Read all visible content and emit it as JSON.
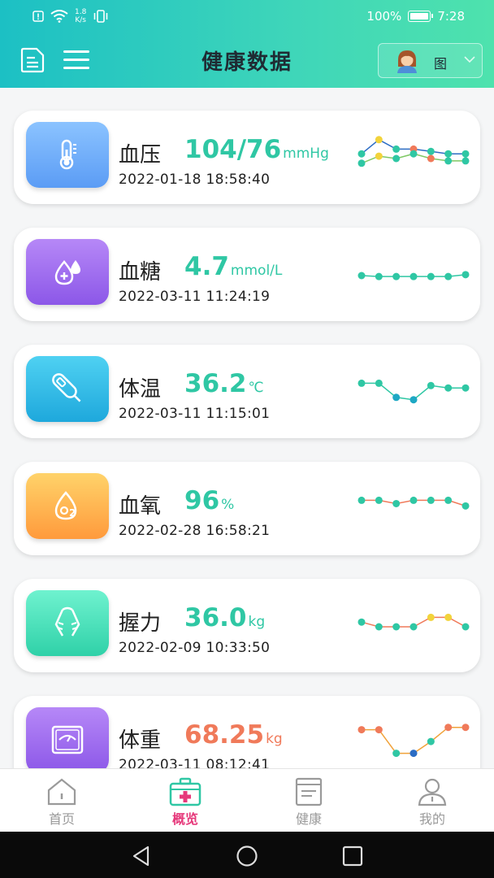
{
  "status_bar": {
    "net_speed_value": "1.8",
    "net_speed_unit": "K/s",
    "battery": "100%",
    "time": "7:28"
  },
  "header": {
    "title": "健康数据",
    "user_label": "图"
  },
  "cards": [
    {
      "name": "血压",
      "value": "104/76",
      "unit": "mmHg",
      "timestamp": "2022-01-18 18:58:40",
      "icon": "thermometer-icon",
      "gradient": [
        "#8bc3ff",
        "#5b9cf5"
      ],
      "value_color": "#2fc7a4",
      "sparkline": {
        "y_range": [
          0,
          10
        ],
        "series": [
          {
            "values": [
              6,
              9,
              7,
              7,
              6.5,
              6,
              6
            ],
            "line_color": "#2b6cc4",
            "points": [
              "#2fc7a4",
              "#f2d33b",
              "#2fc7a4",
              "#f07a5a",
              "#2fc7a4",
              "#2fc7a4",
              "#2fc7a4"
            ]
          },
          {
            "values": [
              4,
              5.5,
              5,
              6,
              5,
              4.5,
              4.5
            ],
            "line_color": "#7ec864",
            "points": [
              "#2fc7a4",
              "#f2d33b",
              "#2fc7a4",
              "#2fc7a4",
              "#f07a5a",
              "#2fc7a4",
              "#2fc7a4"
            ]
          }
        ]
      }
    },
    {
      "name": "血糖",
      "value": "4.7",
      "unit": "mmol/L",
      "timestamp": "2022-03-11 11:24:19",
      "icon": "blood-drop-icon",
      "gradient": [
        "#b688f7",
        "#8c57e8"
      ],
      "value_color": "#2fc7a4",
      "sparkline": {
        "y_range": [
          0,
          10
        ],
        "series": [
          {
            "values": [
              5,
              4.8,
              4.8,
              4.8,
              4.8,
              4.8,
              5.2
            ],
            "line_color": "#2fc7a4",
            "points": [
              "#2fc7a4",
              "#2fc7a4",
              "#2fc7a4",
              "#2fc7a4",
              "#2fc7a4",
              "#2fc7a4",
              "#2fc7a4"
            ]
          }
        ]
      }
    },
    {
      "name": "体温",
      "value": "36.2",
      "unit": "℃",
      "timestamp": "2022-03-11 11:15:01",
      "icon": "digital-thermometer-icon",
      "gradient": [
        "#4fd1f2",
        "#1ea8dc"
      ],
      "value_color": "#2fc7a4",
      "sparkline": {
        "y_range": [
          0,
          10
        ],
        "series": [
          {
            "values": [
              7,
              7,
              4,
              3.5,
              6.5,
              6,
              6
            ],
            "line_color": "#2fc7a4",
            "points": [
              "#2fc7a4",
              "#2fc7a4",
              "#1ea8c4",
              "#1ea8c4",
              "#2fc7a4",
              "#2fc7a4",
              "#2fc7a4"
            ]
          }
        ]
      }
    },
    {
      "name": "血氧",
      "value": "96",
      "unit": "%",
      "timestamp": "2022-02-28 16:58:21",
      "icon": "oxygen-drop-icon",
      "gradient": [
        "#ffd36a",
        "#ff9a3c"
      ],
      "value_color": "#2fc7a4",
      "sparkline": {
        "y_range": [
          0,
          10
        ],
        "series": [
          {
            "values": [
              7,
              7,
              6.3,
              7,
              7,
              7,
              5.8
            ],
            "line_color": "#f07a5a",
            "points": [
              "#2fc7a4",
              "#2fc7a4",
              "#2fc7a4",
              "#2fc7a4",
              "#2fc7a4",
              "#2fc7a4",
              "#2fc7a4"
            ]
          }
        ]
      }
    },
    {
      "name": "握力",
      "value": "36.0",
      "unit": "kg",
      "timestamp": "2022-02-09 10:33:50",
      "icon": "hand-grip-icon",
      "gradient": [
        "#6ff2cf",
        "#2fd1a8"
      ],
      "value_color": "#2fc7a4",
      "sparkline": {
        "y_range": [
          0,
          10
        ],
        "series": [
          {
            "values": [
              6,
              5,
              5,
              5,
              7,
              7,
              5
            ],
            "line_color": "#f07a5a",
            "points": [
              "#2fc7a4",
              "#2fc7a4",
              "#2fc7a4",
              "#2fc7a4",
              "#f2d33b",
              "#f2d33b",
              "#2fc7a4"
            ]
          }
        ]
      }
    },
    {
      "name": "体重",
      "value": "68.25",
      "unit": "kg",
      "timestamp": "2022-03-11 08:12:41",
      "icon": "scale-icon",
      "gradient": [
        "#b688f7",
        "#8c57e8"
      ],
      "value_color": "#f07a5a",
      "sparkline": {
        "y_range": [
          0,
          10
        ],
        "series": [
          {
            "values": [
              8,
              8,
              3,
              3,
              5.5,
              8.5,
              8.5
            ],
            "line_color": "#f0a23a",
            "points": [
              "#f07a5a",
              "#f07a5a",
              "#2fc7a4",
              "#2b6cc4",
              "#2fc7a4",
              "#f07a5a",
              "#f07a5a"
            ]
          }
        ]
      }
    }
  ],
  "nav": {
    "items": [
      {
        "label": "首页",
        "icon": "home-icon"
      },
      {
        "label": "概览",
        "icon": "medical-kit-icon"
      },
      {
        "label": "健康",
        "icon": "health-record-icon"
      },
      {
        "label": "我的",
        "icon": "user-icon"
      }
    ],
    "active_index": 1,
    "active_color": "#e6397b",
    "inactive_color": "#9a9a9a"
  },
  "system_nav": {
    "buttons": [
      "back-icon",
      "home-circle-icon",
      "recents-icon"
    ]
  }
}
